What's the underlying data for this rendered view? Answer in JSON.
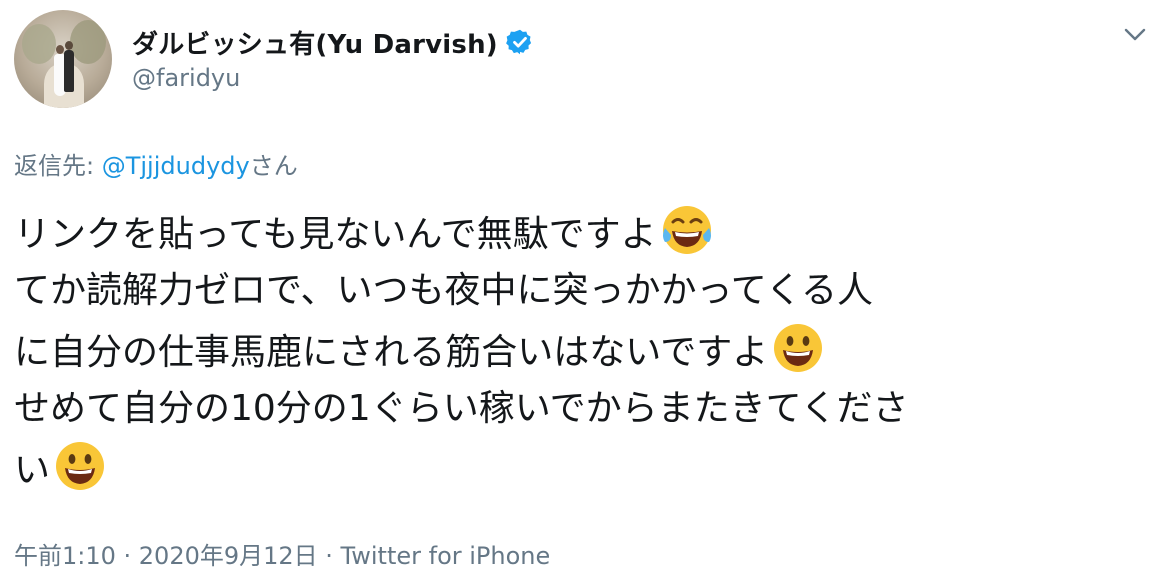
{
  "tweet": {
    "author": {
      "display_name": "ダルビッシュ有(Yu Darvish)",
      "handle": "@faridyu",
      "verified_icon": "verified-badge-icon",
      "avatar_icon": "avatar-photo"
    },
    "reply": {
      "label": "返信先: ",
      "mention": "@Tjjjdudydy",
      "suffix": "さん"
    },
    "text_lines": [
      "リンクを貼っても見ないんで無駄ですよ",
      "てか読解力ゼロで、いつも夜中に突っかかってくる人",
      "に自分の仕事馬鹿にされる筋合いはないですよ",
      "せめて自分の10分の1ぐらい稼いでからまたきてくださ",
      "い"
    ],
    "emojis": [
      "tears-of-joy-emoji",
      "grinning-face-emoji",
      "grinning-face-emoji"
    ],
    "meta": "午前1:10 · 2020年9月12日 · Twitter for iPhone",
    "menu_icon": "chevron-down-icon"
  },
  "colors": {
    "link": "#1b95e0",
    "secondary_text": "#657786",
    "primary_text": "#14171a",
    "verified": "#1da1f2",
    "emoji_yellow": "#f9c637"
  }
}
